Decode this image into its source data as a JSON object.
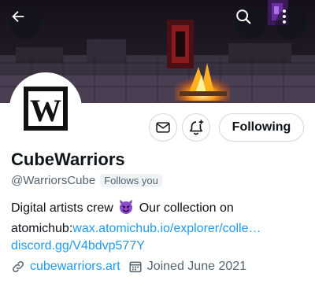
{
  "header": {
    "back_icon": "arrow-left-icon",
    "search_icon": "search-icon",
    "more_icon": "more-vertical-icon"
  },
  "profile": {
    "display_name": "CubeWarriors",
    "handle": "@WarriorsCube",
    "follows_you_badge": "Follows you",
    "avatar_logo_letter": "W"
  },
  "actions": {
    "message_icon": "mail-icon",
    "notify_icon": "bell-plus-icon",
    "following_label": "Following"
  },
  "bio": {
    "line1_text": "Digital artists crew",
    "line1_emoji": "smiling-devil-emoji",
    "line1_after": "Our collection on",
    "line2_prefix": "atomichub:",
    "line2_link": "wax.atomichub.io/explorer/colle…",
    "line3_link": "discord.gg/V4bdvp577Y"
  },
  "meta": {
    "website_icon": "link-icon",
    "website": "cubewarriors.art",
    "joined_icon": "calendar-icon",
    "joined": "Joined June 2021"
  },
  "colors": {
    "accent": "#1d9bf0",
    "secondary_text": "#536471",
    "primary_text": "#0f1419"
  }
}
